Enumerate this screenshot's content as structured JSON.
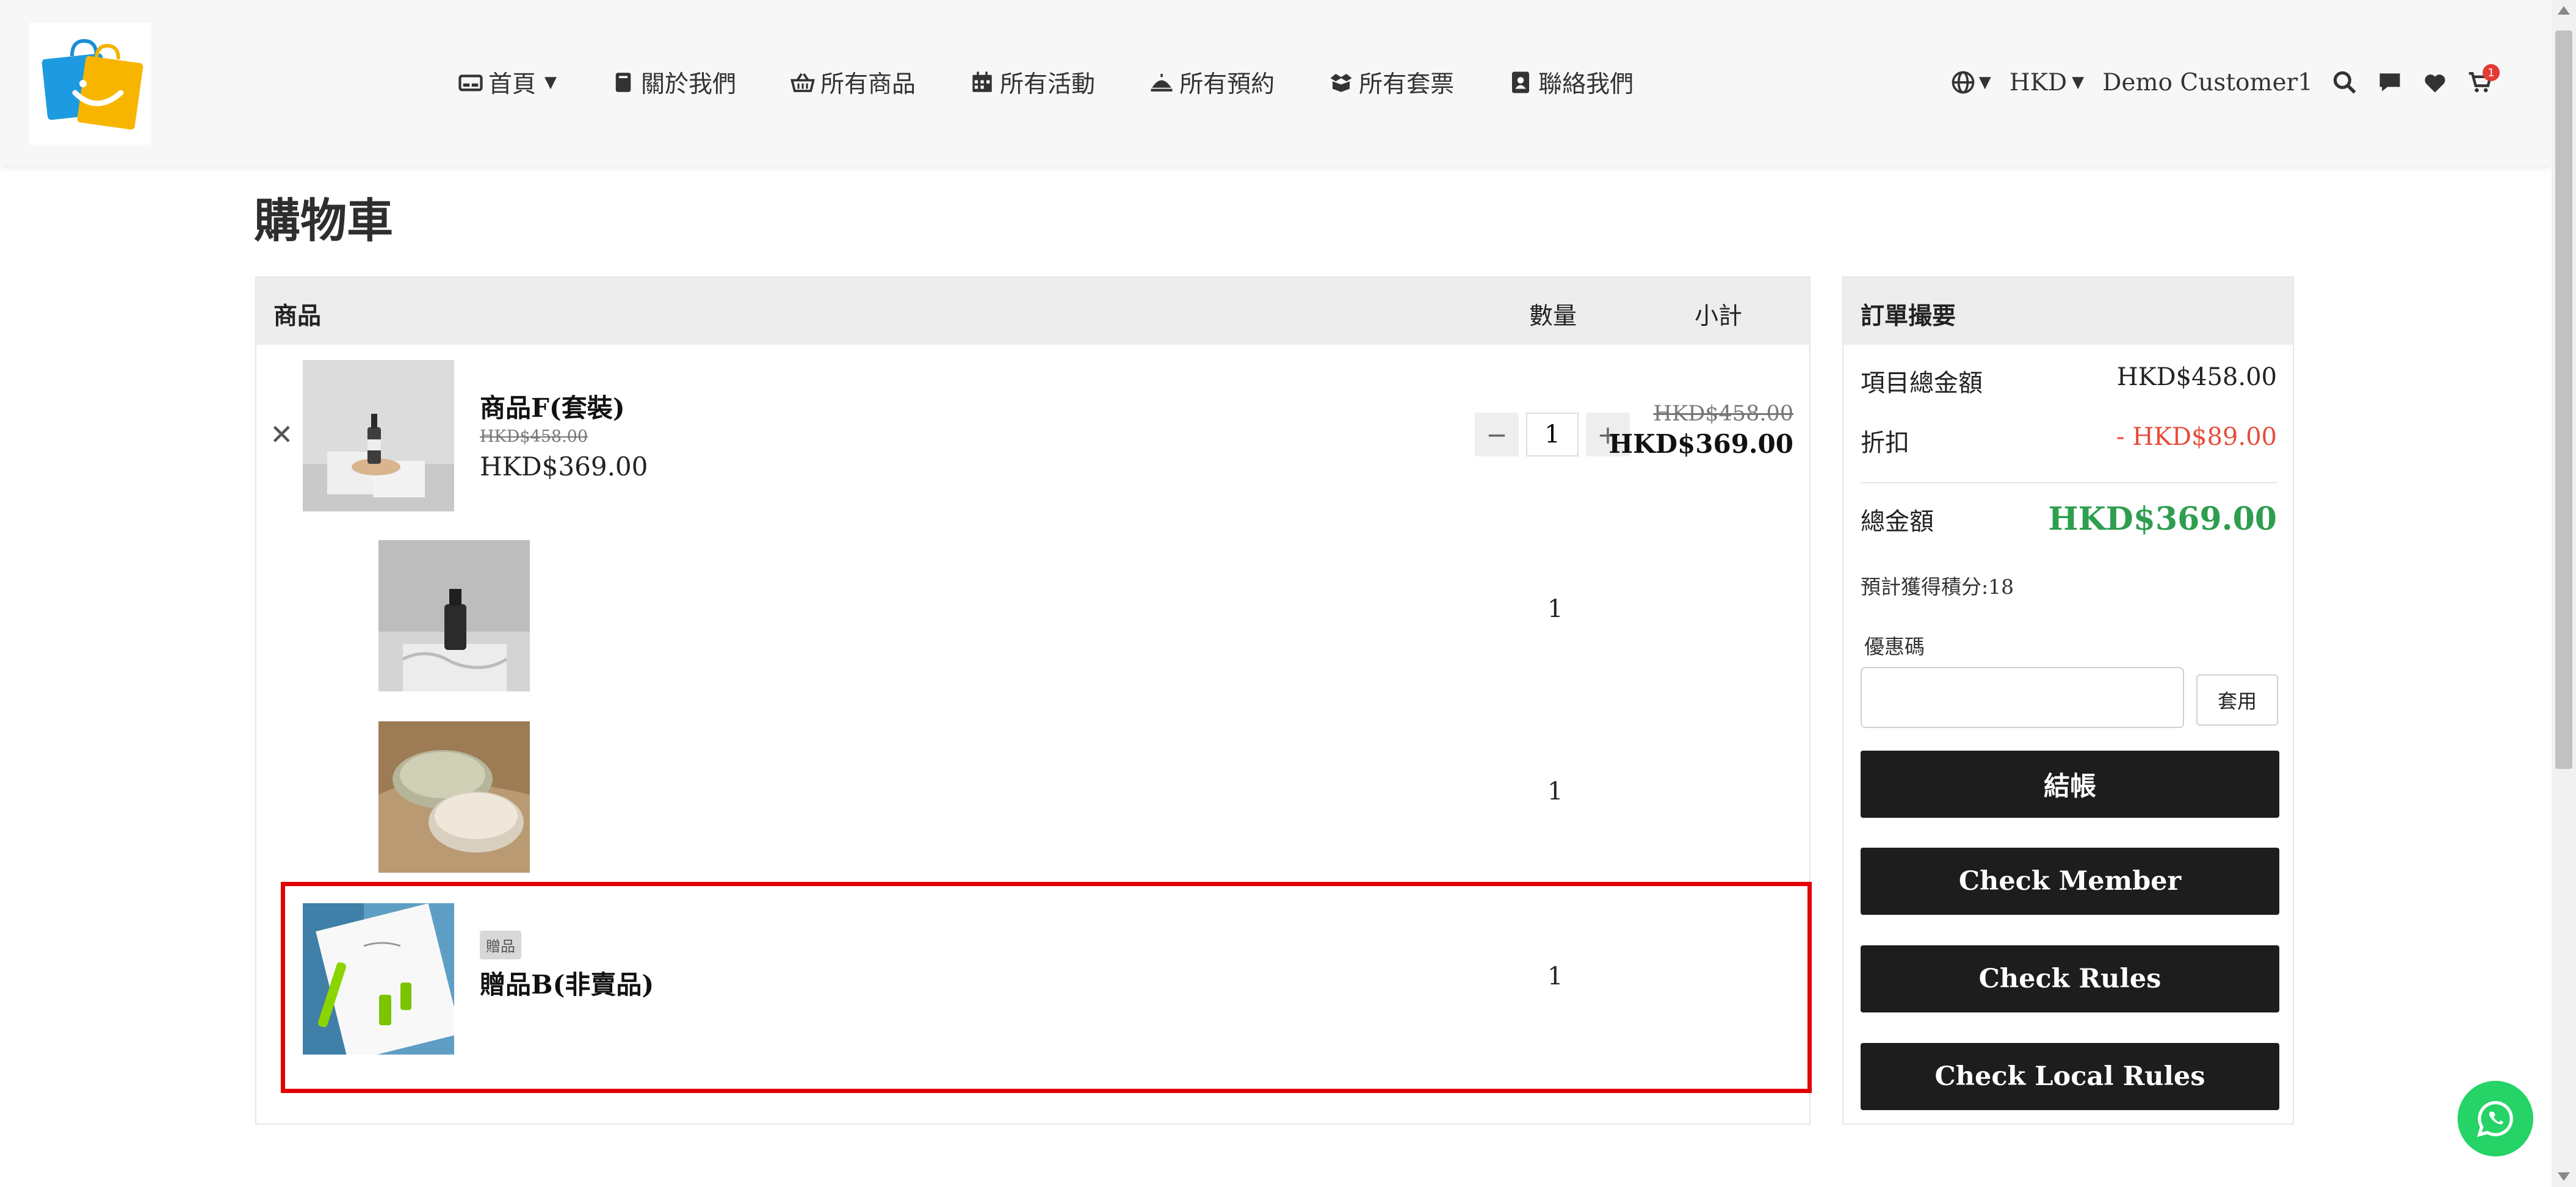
{
  "header": {
    "nav": [
      {
        "label": "首頁",
        "icon": "home-card-icon"
      },
      {
        "label": "關於我們",
        "icon": "book-icon"
      },
      {
        "label": "所有商品",
        "icon": "basket-icon"
      },
      {
        "label": "所有活動",
        "icon": "calendar-icon"
      },
      {
        "label": "所有預約",
        "icon": "service-bell-icon"
      },
      {
        "label": "所有套票",
        "icon": "box-open-icon"
      },
      {
        "label": "聯絡我們",
        "icon": "address-book-icon"
      }
    ],
    "currency": "HKD",
    "user_name": "Demo Customer1",
    "cart_count": "1"
  },
  "page": {
    "title": "購物車"
  },
  "cart": {
    "headers": {
      "product": "商品",
      "quantity": "數量",
      "subtotal": "小計"
    },
    "main_item": {
      "name": "商品F(套裝)",
      "original_price": "HKD$458.00",
      "price": "HKD$369.00",
      "quantity": "1",
      "subtotal_original": "HKD$458.00",
      "subtotal": "HKD$369.00"
    },
    "bundle_items": [
      {
        "quantity": "1"
      },
      {
        "quantity": "1"
      }
    ],
    "gift_item": {
      "tag": "贈品",
      "name": "贈品B(非賣品)",
      "quantity": "1"
    }
  },
  "summary": {
    "title": "訂單撮要",
    "items_total_label": "項目總金額",
    "items_total_value": "HKD$458.00",
    "discount_label": "折扣",
    "discount_value": "- HKD$89.00",
    "grand_total_label": "總金額",
    "grand_total_value": "HKD$369.00",
    "points_text": "預計獲得積分:18",
    "coupon_label": "優惠碼",
    "coupon_value": "",
    "coupon_apply": "套用",
    "checkout_button": "結帳",
    "check_member_button": "Check Member",
    "check_rules_button": "Check Rules",
    "check_local_rules_button": "Check Local Rules"
  },
  "colors": {
    "accent_green": "#2e9e4f",
    "discount_red": "#e74c3c",
    "highlight_red": "#e20000",
    "button_dark": "#1d1d1d",
    "whatsapp_green": "#25d366"
  }
}
